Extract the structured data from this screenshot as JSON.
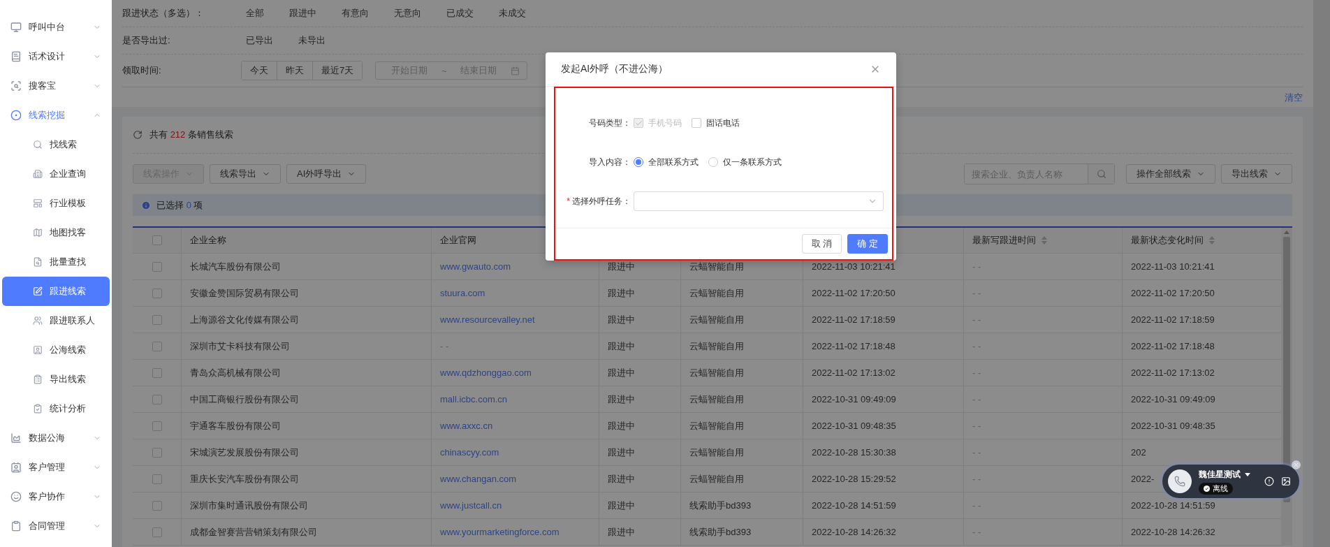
{
  "sidebar": {
    "items": [
      {
        "label": "呼叫中台",
        "expanded": false
      },
      {
        "label": "话术设计",
        "expanded": false
      },
      {
        "label": "搜客宝",
        "expanded": false
      },
      {
        "label": "线索挖掘",
        "expanded": true,
        "children": [
          {
            "label": "找线索",
            "selected": false
          },
          {
            "label": "企业查询",
            "selected": false
          },
          {
            "label": "行业模板",
            "selected": false
          },
          {
            "label": "地图找客",
            "selected": false
          },
          {
            "label": "批量查找",
            "selected": false
          },
          {
            "label": "跟进线索",
            "selected": true
          },
          {
            "label": "跟进联系人",
            "selected": false
          },
          {
            "label": "公海线索",
            "selected": false
          },
          {
            "label": "导出线索",
            "selected": false
          },
          {
            "label": "统计分析",
            "selected": false
          }
        ]
      },
      {
        "label": "数据公海",
        "expanded": false
      },
      {
        "label": "客户管理",
        "expanded": false
      },
      {
        "label": "客户协作",
        "expanded": false
      },
      {
        "label": "合同管理",
        "expanded": false
      }
    ]
  },
  "filters": [
    {
      "kind": "options",
      "label": "跟进状态（多选）：",
      "options": [
        "全部",
        "跟进中",
        "有意向",
        "无意向",
        "已成交",
        "未成交"
      ]
    },
    {
      "kind": "options",
      "label": "是否导出过:",
      "options": [
        "已导出",
        "未导出"
      ]
    },
    {
      "kind": "date",
      "label": "领取时间:",
      "quick": [
        "今天",
        "昨天",
        "最近7天"
      ],
      "start_placeholder": "开始日期",
      "separator": "~",
      "end_placeholder": "结束日期"
    }
  ],
  "clear_link": "清空",
  "summary": {
    "prefix": "共有",
    "count": "212",
    "suffix": "条销售线索"
  },
  "toolbar": {
    "left": [
      {
        "label": "线索操作",
        "disabled": true
      },
      {
        "label": "线索导出",
        "disabled": false
      },
      {
        "label": "AI外呼导出",
        "disabled": false
      }
    ],
    "search_placeholder": "搜索企业、负责人名称",
    "right": [
      {
        "label": "操作全部线索",
        "disabled": false
      },
      {
        "label": "导出线索",
        "disabled": false
      }
    ]
  },
  "selection": {
    "prefix": "已选择",
    "count": "0",
    "suffix": "项"
  },
  "table": {
    "select_all_checked": false,
    "columns": [
      {
        "label": "企业全称",
        "sortable": false
      },
      {
        "label": "企业官网",
        "sortable": false
      },
      {},
      {},
      {},
      {
        "label": "最新写跟进时间",
        "sortable": true
      },
      {
        "label": "最新状态变化时间",
        "sortable": true
      }
    ],
    "rows": [
      {
        "checked": false,
        "name": "长城汽车股份有限公司",
        "website": {
          "text": "www.gwauto.com",
          "link": true
        },
        "status": "跟进中",
        "source": "云蝠智能自用",
        "created": "2022-11-03 10:21:41",
        "last_follow": "- -",
        "state_changed": "2022-11-03 10:21:41"
      },
      {
        "checked": false,
        "name": "安徽金赞国际贸易有限公司",
        "website": {
          "text": "stuura.com",
          "link": true
        },
        "status": "跟进中",
        "source": "云蝠智能自用",
        "created": "2022-11-02 17:20:50",
        "last_follow": "- -",
        "state_changed": "2022-11-02 17:20:50"
      },
      {
        "checked": false,
        "name": "上海源谷文化传媒有限公司",
        "website": {
          "text": "www.resourcevalley.net",
          "link": true
        },
        "status": "跟进中",
        "source": "云蝠智能自用",
        "created": "2022-11-02 17:18:59",
        "last_follow": "- -",
        "state_changed": "2022-11-02 17:18:59"
      },
      {
        "checked": false,
        "name": "深圳市艾卡科技有限公司",
        "website": {
          "text": "- -",
          "link": false
        },
        "status": "跟进中",
        "source": "云蝠智能自用",
        "created": "2022-11-02 17:18:48",
        "last_follow": "- -",
        "state_changed": "2022-11-02 17:18:48"
      },
      {
        "checked": false,
        "name": "青岛众高机械有限公司",
        "website": {
          "text": "www.qdzhonggao.com",
          "link": true
        },
        "status": "跟进中",
        "source": "云蝠智能自用",
        "created": "2022-11-02 17:13:02",
        "last_follow": "- -",
        "state_changed": "2022-11-02 17:13:02"
      },
      {
        "checked": false,
        "name": "中国工商银行股份有限公司",
        "website": {
          "text": "mall.icbc.com.cn",
          "link": true
        },
        "status": "跟进中",
        "source": "云蝠智能自用",
        "created": "2022-10-31 09:49:09",
        "last_follow": "- -",
        "state_changed": "2022-10-31 09:49:09"
      },
      {
        "checked": false,
        "name": "宇通客车股份有限公司",
        "website": {
          "text": "www.axxc.cn",
          "link": true
        },
        "status": "跟进中",
        "source": "云蝠智能自用",
        "created": "2022-10-31 09:48:35",
        "last_follow": "- -",
        "state_changed": "2022-10-31 09:48:35"
      },
      {
        "checked": false,
        "name": "宋城演艺发展股份有限公司",
        "website": {
          "text": "chinascyy.com",
          "link": true
        },
        "status": "跟进中",
        "source": "云蝠智能自用",
        "created": "2022-10-28 15:30:38",
        "last_follow": "- -",
        "state_changed": "202"
      },
      {
        "checked": false,
        "name": "重庆长安汽车股份有限公司",
        "website": {
          "text": "www.changan.com",
          "link": true
        },
        "status": "跟进中",
        "source": "云蝠智能自用",
        "created": "2022-10-28 15:29:52",
        "last_follow": "- -",
        "state_changed": "2022-"
      },
      {
        "checked": false,
        "name": "深圳市集时通讯股份有限公司",
        "website": {
          "text": "www.justcall.cn",
          "link": true
        },
        "status": "跟进中",
        "source": "线索助手bd393",
        "created": "2022-10-28 14:51:59",
        "last_follow": "- -",
        "state_changed": "2022-10-28 14:51:59"
      },
      {
        "checked": false,
        "name": "成都金智赛营营销策划有限公司",
        "website": {
          "text": "www.yourmarketingforce.com",
          "link": true
        },
        "status": "跟进中",
        "source": "线索助手bd393",
        "created": "2022-10-28 14:26:32",
        "last_follow": "- -",
        "state_changed": "2022-10-28 14:26:32"
      }
    ]
  },
  "dialog": {
    "title": "发起AI外呼（不进公海）",
    "fields": [
      {
        "kind": "checkbox",
        "label": "号码类型：",
        "options": [
          {
            "label": "手机号码",
            "checked": true,
            "disabled": true
          },
          {
            "label": "固话电话",
            "checked": false,
            "disabled": false
          }
        ]
      },
      {
        "kind": "radio",
        "label": "导入内容：",
        "options": [
          {
            "label": "全部联系方式",
            "selected": true
          },
          {
            "label": "仅一条联系方式",
            "selected": false
          }
        ]
      },
      {
        "kind": "select",
        "label": "选择外呼任务：",
        "required_mark": "*"
      }
    ],
    "buttons": [
      {
        "label": "取 消",
        "kind": "default"
      },
      {
        "label": "确 定",
        "kind": "primary"
      }
    ]
  },
  "call_widget": {
    "name": "魏佳星测试",
    "status": "离线"
  }
}
